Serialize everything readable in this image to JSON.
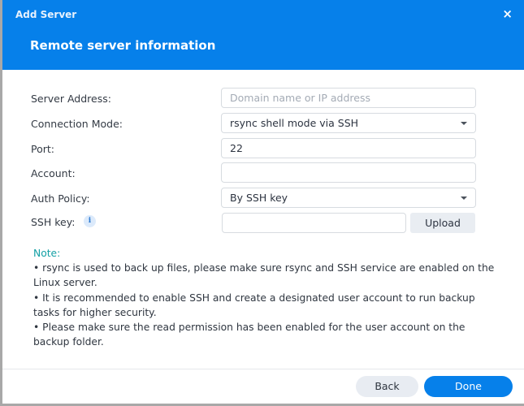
{
  "dialog": {
    "title": "Add Server",
    "close_icon": "×",
    "subtitle": "Remote server information"
  },
  "form": {
    "server_address": {
      "label": "Server Address:",
      "value": "",
      "placeholder": "Domain name or IP address"
    },
    "connection_mode": {
      "label": "Connection Mode:",
      "value": "rsync shell mode via SSH"
    },
    "port": {
      "label": "Port:",
      "value": "22"
    },
    "account": {
      "label": "Account:",
      "value": ""
    },
    "auth_policy": {
      "label": "Auth Policy:",
      "value": "By SSH key"
    },
    "ssh_key": {
      "label": "SSH key:",
      "value": "",
      "info_icon": "i",
      "upload_label": "Upload"
    }
  },
  "note": {
    "title": "Note:",
    "items": [
      "• rsync is used to back up files, please make sure rsync and SSH service are enabled on the Linux server.",
      "• It is recommended to enable SSH and create a designated user account to run backup tasks for higher security.",
      "• Please make sure the read permission has been enabled for the user account on the backup folder."
    ]
  },
  "footer": {
    "back_label": "Back",
    "done_label": "Done"
  },
  "colors": {
    "accent": "#0680ea",
    "note_title": "#14a0a5"
  }
}
